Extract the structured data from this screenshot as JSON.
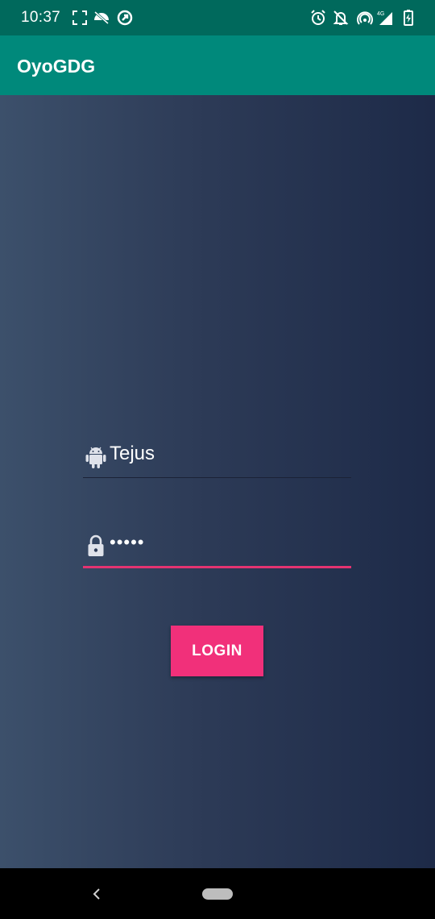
{
  "status_bar": {
    "time": "10:37",
    "left_icons": [
      "screenshot-frame-icon",
      "mobile-data-saver-icon",
      "sync-icon"
    ],
    "right_icons": [
      "alarm-icon",
      "notifications-off-icon",
      "hotspot-icon",
      "signal-4g-icon",
      "battery-charging-icon"
    ],
    "network_label": "4G"
  },
  "app_bar": {
    "title": "OyoGDG",
    "color": "#00897b"
  },
  "login_form": {
    "username": {
      "icon": "android-icon",
      "value": "Tejus"
    },
    "password": {
      "icon": "lock-icon",
      "value": "•••••"
    },
    "login_button": "LOGIN",
    "accent_color": "#f1307a"
  },
  "nav_bar": {
    "icons": [
      "back-icon",
      "home-pill-icon"
    ]
  }
}
